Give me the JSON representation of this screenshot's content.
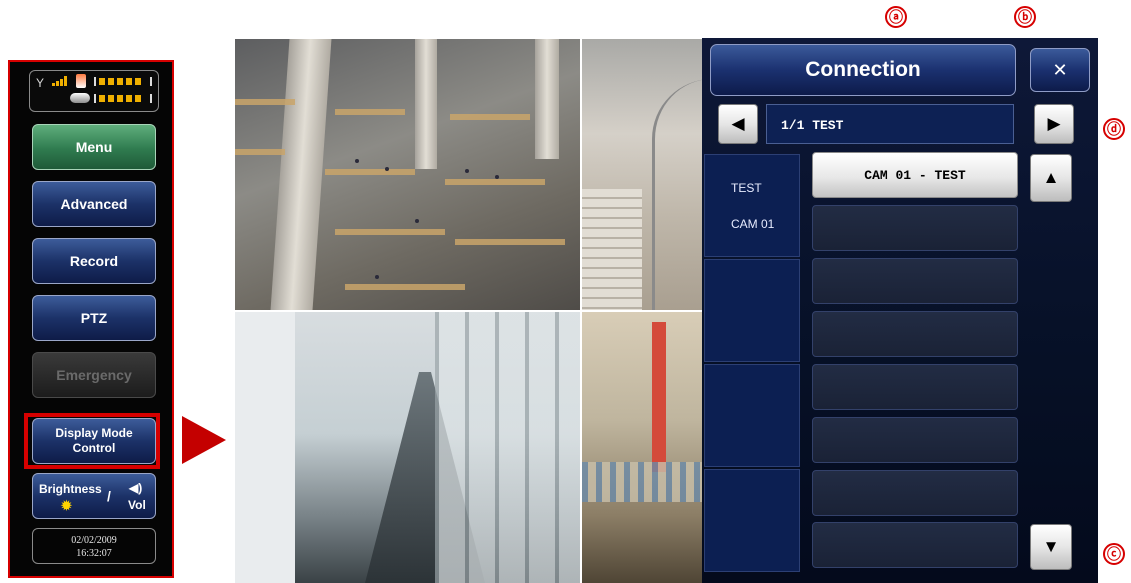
{
  "left_panel": {
    "menu_label": "Menu",
    "advanced_label": "Advanced",
    "record_label": "Record",
    "ptz_label": "PTZ",
    "emergency_label": "Emergency",
    "display_mode_line1": "Display Mode",
    "display_mode_line2": "Control",
    "brightness_label": "Brightness",
    "slash": "/",
    "vol_label": "Vol",
    "date": "02/02/2009",
    "time": "16:32:07"
  },
  "dialog": {
    "title": "Connection",
    "close_glyph": "✕",
    "prev_glyph": "◀",
    "next_glyph": "▶",
    "up_glyph": "▲",
    "down_glyph": "▼",
    "group_text": "1/1 TEST",
    "site_name": "TEST",
    "site_camera": "CAM 01",
    "active_slot": "CAM 01 - TEST"
  },
  "callouts": {
    "a": "ⓐ",
    "b": "ⓑ",
    "c": "ⓒ",
    "d": "ⓓ"
  },
  "icons": {
    "signal": "antenna-signal-icon",
    "battery": "battery-icon",
    "hdd": "hdd-icon",
    "sun": "sun-icon",
    "speaker": "speaker-icon"
  },
  "colors": {
    "highlight_red": "#d60000",
    "button_blue": "#1c3268",
    "menu_green": "#2f7b4f"
  }
}
